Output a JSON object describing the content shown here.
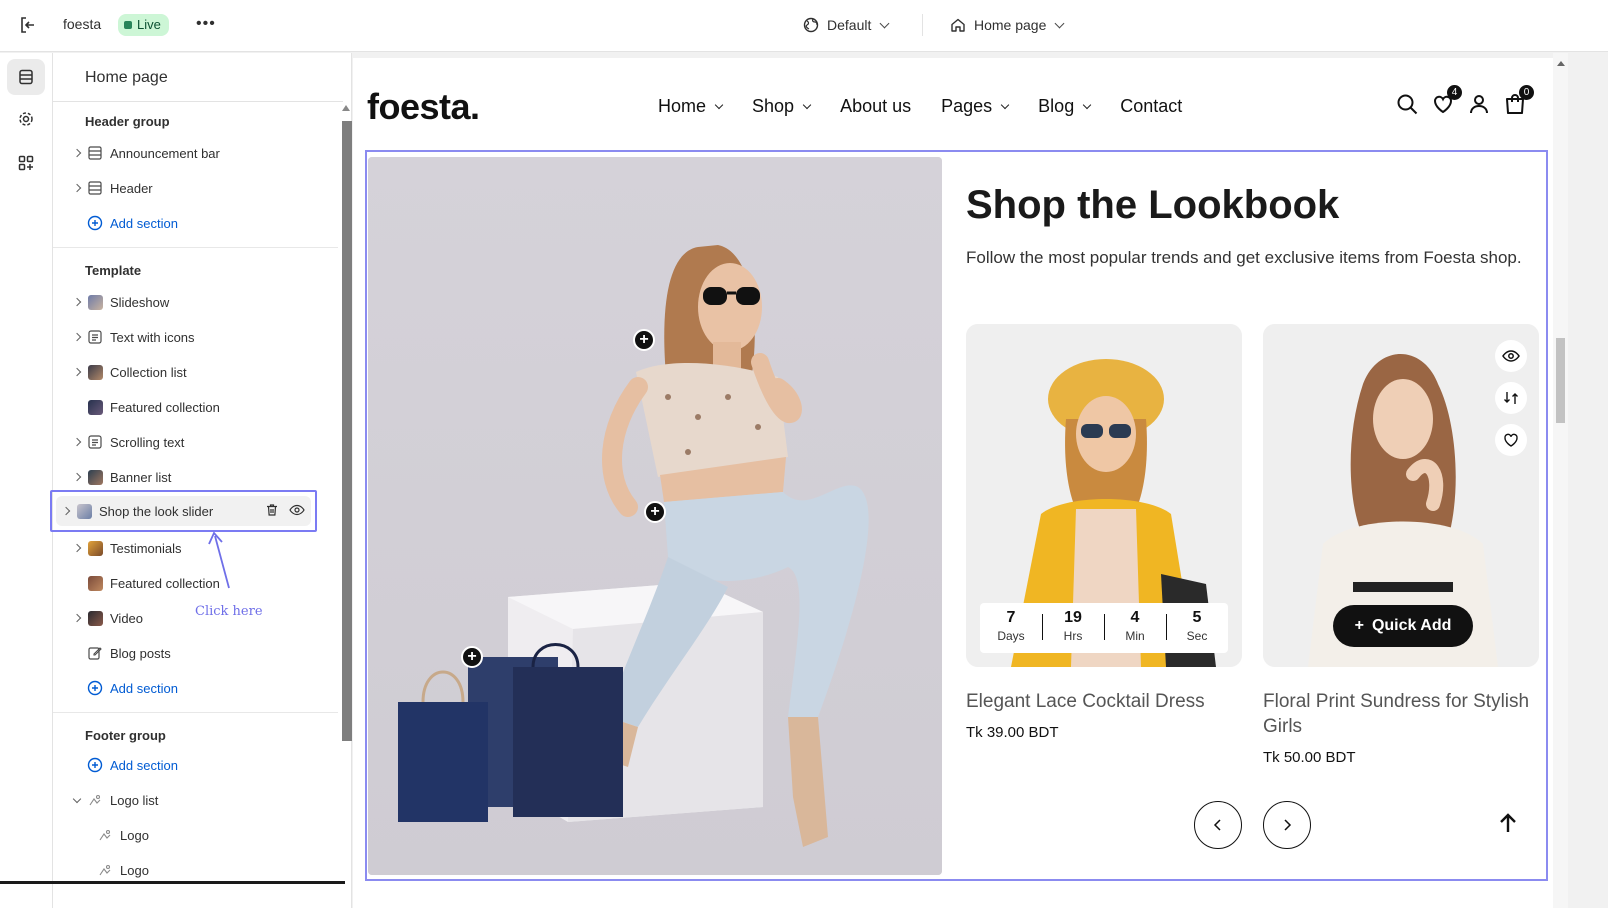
{
  "topbar": {
    "store_name": "foesta",
    "status_badge": "Live",
    "more_label": "•••",
    "theme_select": "Default",
    "page_select": "Home page"
  },
  "panel": {
    "title": "Home page",
    "header_group": {
      "title": "Header group",
      "items": [
        {
          "label": "Announcement bar",
          "icon": "section-layout-icon",
          "expandable": true
        },
        {
          "label": "Header",
          "icon": "section-layout-icon",
          "expandable": true
        }
      ],
      "add_label": "Add section"
    },
    "template": {
      "title": "Template",
      "items": [
        {
          "label": "Slideshow",
          "icon": "image-thumb",
          "expandable": true
        },
        {
          "label": "Text with icons",
          "icon": "text-block-icon",
          "expandable": true
        },
        {
          "label": "Collection list",
          "icon": "image-thumb",
          "expandable": true
        },
        {
          "label": "Featured collection",
          "icon": "image-thumb",
          "expandable": false
        },
        {
          "label": "Scrolling text",
          "icon": "text-block-icon",
          "expandable": true
        },
        {
          "label": "Banner list",
          "icon": "image-thumb",
          "expandable": true
        },
        {
          "label": "Shop the look slider",
          "icon": "image-thumb",
          "expandable": true,
          "selected": true
        },
        {
          "label": "Testimonials",
          "icon": "image-thumb",
          "expandable": true
        },
        {
          "label": "Featured collection",
          "icon": "image-thumb",
          "expandable": false
        },
        {
          "label": "Video",
          "icon": "image-thumb",
          "expandable": true
        },
        {
          "label": "Blog posts",
          "icon": "edit-icon",
          "expandable": false
        }
      ],
      "add_label": "Add section"
    },
    "footer_group": {
      "title": "Footer group",
      "add_label": "Add section",
      "items": [
        {
          "label": "Logo list",
          "expanded": true
        },
        {
          "label": "Logo"
        },
        {
          "label": "Logo"
        }
      ]
    },
    "annotation": "Click here"
  },
  "site": {
    "logo": "foesta.",
    "nav": [
      {
        "label": "Home",
        "dropdown": true
      },
      {
        "label": "Shop",
        "dropdown": true
      },
      {
        "label": "About us",
        "dropdown": false
      },
      {
        "label": "Pages",
        "dropdown": true
      },
      {
        "label": "Blog",
        "dropdown": true
      },
      {
        "label": "Contact",
        "dropdown": false
      }
    ],
    "wishlist_count": "4",
    "cart_count": "0"
  },
  "lookbook": {
    "title": "Shop the Lookbook",
    "subtitle": "Follow the most popular trends and get exclusive items from Foesta shop.",
    "hotspot_symbol": "+",
    "products": [
      {
        "name": "Elegant Lace Cocktail Dress",
        "price": "Tk 39.00 BDT",
        "countdown": [
          {
            "value": "7",
            "label": "Days"
          },
          {
            "value": "19",
            "label": "Hrs"
          },
          {
            "value": "4",
            "label": "Min"
          },
          {
            "value": "5",
            "label": "Sec"
          }
        ]
      },
      {
        "name": "Floral Print Sundress for Stylish Girls",
        "price": "Tk 50.00 BDT",
        "quick_add": "Quick Add"
      }
    ]
  },
  "colors": {
    "accent_outline": "#8b8bf0",
    "live_badge_bg": "#cdf6d6",
    "link_blue": "#005bd3"
  }
}
